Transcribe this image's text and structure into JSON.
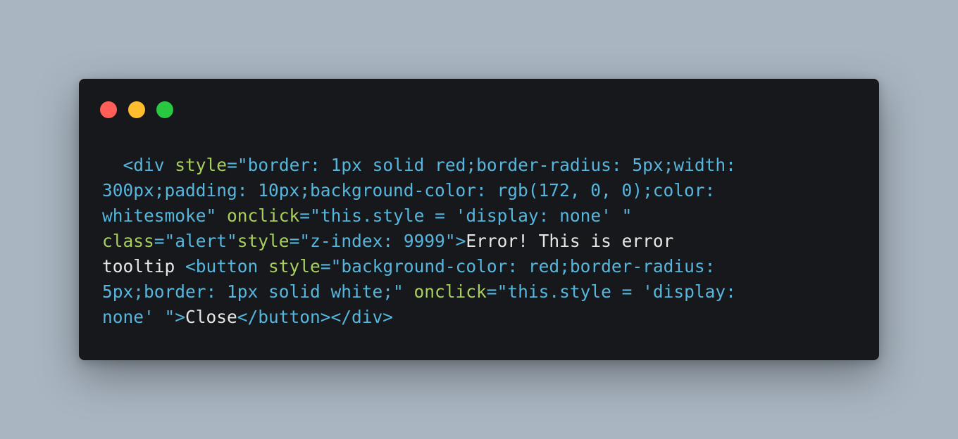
{
  "colors": {
    "background": "#a9b5c1",
    "window": "#17181b",
    "close": "#ff5f57",
    "minimize": "#febc2e",
    "maximize": "#28c840",
    "tag": "#56b6dd",
    "attribute": "#a8cf5e",
    "text": "#e6e6e6"
  },
  "window_controls": [
    "close",
    "minimize",
    "maximize"
  ],
  "code_lines": [
    [
      {
        "t": "  ",
        "k": "text"
      },
      {
        "t": "<div",
        "k": "tag"
      },
      {
        "t": " ",
        "k": "text"
      },
      {
        "t": "style",
        "k": "attr"
      },
      {
        "t": "=",
        "k": "punc"
      },
      {
        "t": "\"border: 1px solid red;border-radius: 5px;width:",
        "k": "str"
      }
    ],
    [
      {
        "t": "300px;padding: 10px;background-color: rgb(172, 0, 0);color:",
        "k": "str"
      }
    ],
    [
      {
        "t": "whitesmoke\"",
        "k": "str"
      },
      {
        "t": " ",
        "k": "text"
      },
      {
        "t": "onclick",
        "k": "attr"
      },
      {
        "t": "=",
        "k": "punc"
      },
      {
        "t": "\"this.style = 'display: none' \"",
        "k": "str"
      }
    ],
    [
      {
        "t": "class",
        "k": "attr"
      },
      {
        "t": "=",
        "k": "punc"
      },
      {
        "t": "\"alert\"",
        "k": "str"
      },
      {
        "t": "style",
        "k": "attr"
      },
      {
        "t": "=",
        "k": "punc"
      },
      {
        "t": "\"z-index: 9999\"",
        "k": "str"
      },
      {
        "t": ">",
        "k": "tag"
      },
      {
        "t": "Error! This is error",
        "k": "text"
      }
    ],
    [
      {
        "t": "tooltip ",
        "k": "text"
      },
      {
        "t": "<button",
        "k": "tag"
      },
      {
        "t": " ",
        "k": "text"
      },
      {
        "t": "style",
        "k": "attr"
      },
      {
        "t": "=",
        "k": "punc"
      },
      {
        "t": "\"background-color: red;border-radius:",
        "k": "str"
      }
    ],
    [
      {
        "t": "5px;border: 1px solid white;\"",
        "k": "str"
      },
      {
        "t": " ",
        "k": "text"
      },
      {
        "t": "onclick",
        "k": "attr"
      },
      {
        "t": "=",
        "k": "punc"
      },
      {
        "t": "\"this.style = 'display:",
        "k": "str"
      }
    ],
    [
      {
        "t": "none' \"",
        "k": "str"
      },
      {
        "t": ">",
        "k": "tag"
      },
      {
        "t": "Close",
        "k": "text"
      },
      {
        "t": "</button></div>",
        "k": "tag"
      }
    ]
  ]
}
